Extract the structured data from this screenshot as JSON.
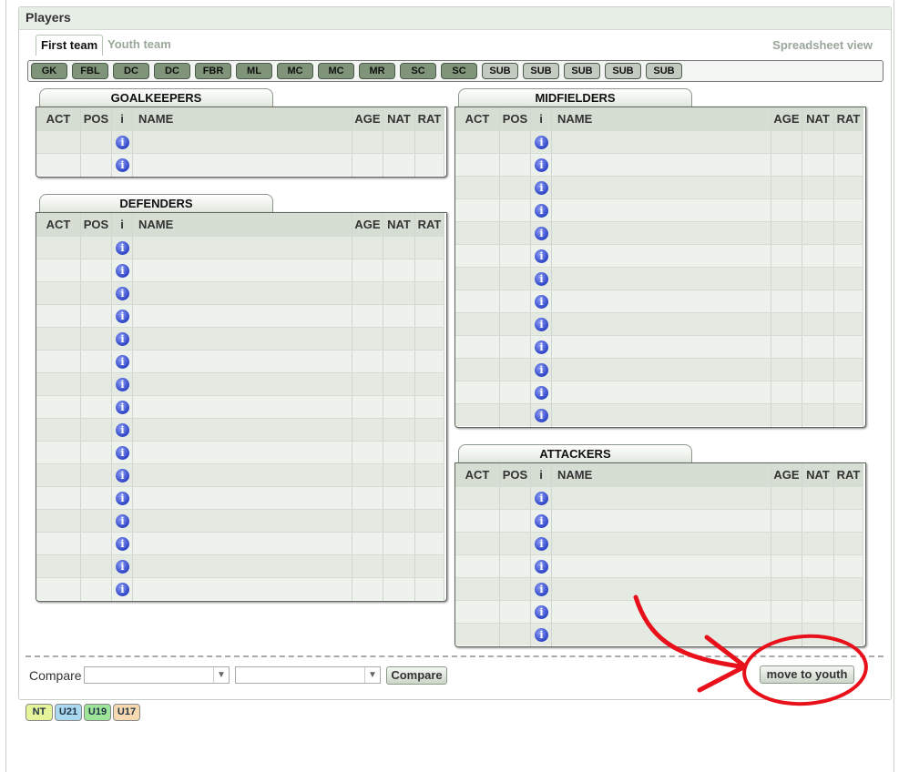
{
  "panel": {
    "title": "Players"
  },
  "tabs": [
    {
      "label": "First team",
      "active": true
    },
    {
      "label": "Youth team",
      "active": false
    }
  ],
  "spreadsheet_view": "Spreadsheet view",
  "positions": [
    "GK",
    "FBL",
    "DC",
    "DC",
    "FBR",
    "ML",
    "MC",
    "MC",
    "MR",
    "SC",
    "SC",
    "SUB",
    "SUB",
    "SUB",
    "SUB",
    "SUB"
  ],
  "columns": {
    "act": "ACT",
    "pos": "POS",
    "info": "i",
    "name": "NAME",
    "age": "AGE",
    "nat": "NAT",
    "rat": "RAT"
  },
  "sections": {
    "goalkeepers": {
      "title": "GOALKEEPERS",
      "rows": 2
    },
    "defenders": {
      "title": "DEFENDERS",
      "rows": 16
    },
    "midfielders": {
      "title": "MIDFIELDERS",
      "rows": 13
    },
    "attackers": {
      "title": "ATTACKERS",
      "rows": 7
    }
  },
  "info_icon_glyph": "i",
  "compare": {
    "label": "Compare",
    "select1_value": "",
    "select2_value": "",
    "button": "Compare"
  },
  "move_to_youth": "move to youth",
  "badges": [
    {
      "label": "NT",
      "color": "#e6f59a"
    },
    {
      "label": "U21",
      "color": "#a9d8f0"
    },
    {
      "label": "U19",
      "color": "#9ee59a"
    },
    {
      "label": "U17",
      "color": "#f6d9b0"
    }
  ],
  "colors": {
    "annotation": "#e8101a",
    "header_bg": "#d6ddd3",
    "row_odd": "#e4eae1",
    "row_even": "#eef2ec"
  }
}
